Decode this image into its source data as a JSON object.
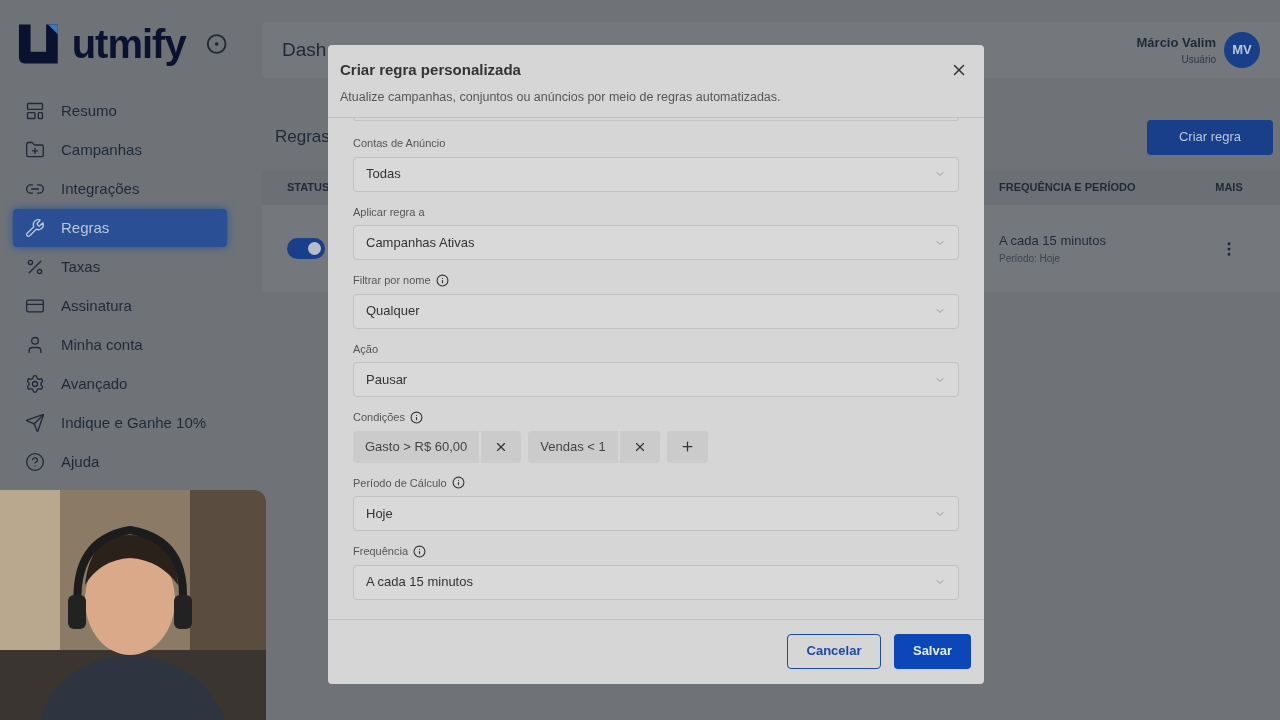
{
  "sidebar": {
    "logo": "utmify",
    "items": [
      {
        "label": "Resumo",
        "selected": false
      },
      {
        "label": "Campanhas",
        "selected": false
      },
      {
        "label": "Integrações",
        "selected": false
      },
      {
        "label": "Regras",
        "selected": true
      },
      {
        "label": "Taxas",
        "selected": false
      },
      {
        "label": "Assinatura",
        "selected": false
      },
      {
        "label": "Minha conta",
        "selected": false
      },
      {
        "label": "Avançado",
        "selected": false
      },
      {
        "label": "Indique e Ganhe 10%",
        "selected": false
      },
      {
        "label": "Ajuda",
        "selected": false
      }
    ]
  },
  "header": {
    "title": "Dash",
    "user_name": "Márcio Valim",
    "user_role": "Usuário",
    "avatar": "MV"
  },
  "page": {
    "title": "Regras",
    "create_button": "Criar regra"
  },
  "table": {
    "columns": [
      "STATUS",
      "FREQUÊNCIA E PERÍODO",
      "MAIS"
    ],
    "rows": [
      {
        "on": true,
        "frequency": "A cada 15 minutos",
        "period": "Período: Hoje"
      }
    ]
  },
  "modal": {
    "title": "Criar regra personalizada",
    "subtitle": "Atualize campanhas, conjuntos ou anúncios por meio de regras automatizadas.",
    "fields": [
      {
        "kind": "select",
        "label": "Contas de Anúncio",
        "info": false,
        "value": "Todas"
      },
      {
        "kind": "select",
        "label": "Aplicar regra a",
        "info": false,
        "value": "Campanhas Ativas"
      },
      {
        "kind": "select",
        "label": "Filtrar por nome",
        "info": true,
        "value": "Qualquer"
      },
      {
        "kind": "select",
        "label": "Ação",
        "info": false,
        "value": "Pausar"
      },
      {
        "kind": "conditions",
        "label": "Condições",
        "info": true,
        "chips": [
          "Gasto > R$ 60,00",
          "Vendas < 1"
        ]
      },
      {
        "kind": "select",
        "label": "Período de Cálculo",
        "info": true,
        "value": "Hoje"
      },
      {
        "kind": "select",
        "label": "Frequência",
        "info": true,
        "value": "A cada 15 minutos"
      }
    ],
    "cancel": "Cancelar",
    "save": "Salvar"
  }
}
